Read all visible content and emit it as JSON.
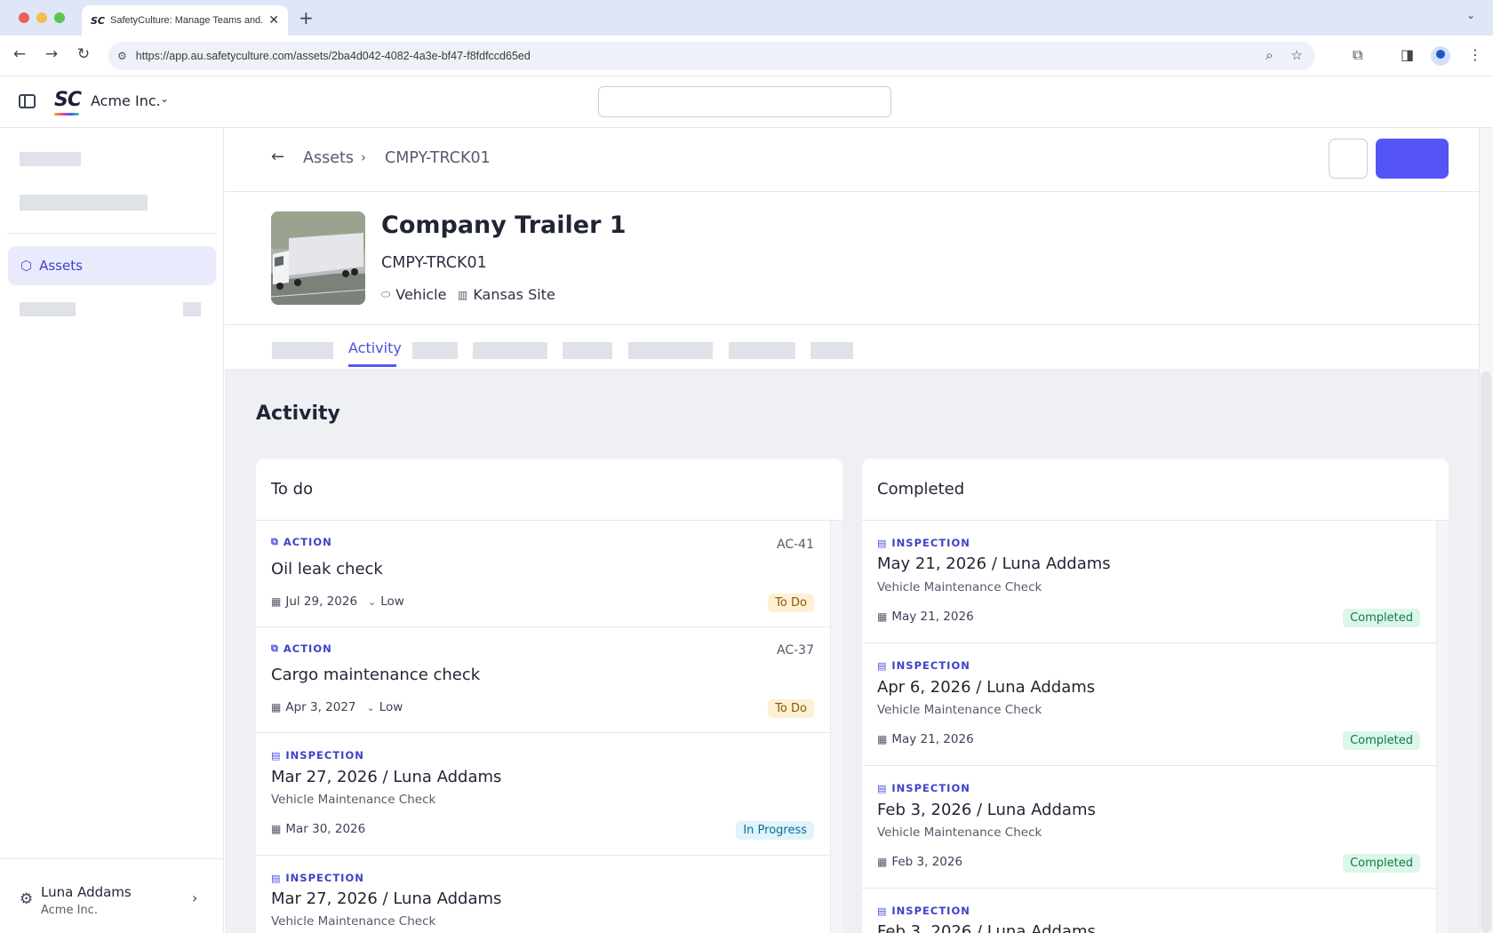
{
  "browser": {
    "tab_title": "SafetyCulture: Manage Teams and...",
    "tab_favicon": "SC",
    "url": "https://app.au.safetyculture.com/assets/2ba4d042-4082-4a3e-bf47-f8fdfccd65ed"
  },
  "header": {
    "logo": "SC",
    "org_name": "Acme Inc."
  },
  "sidebar": {
    "active_item": "Assets",
    "user": {
      "name": "Luna Addams",
      "org": "Acme Inc."
    }
  },
  "breadcrumb": {
    "parent": "Assets",
    "current": "CMPY-TRCK01"
  },
  "asset": {
    "title": "Company Trailer 1",
    "code": "CMPY-TRCK01",
    "type": "Vehicle",
    "site": "Kansas Site"
  },
  "tabs": {
    "active": "Activity"
  },
  "activity": {
    "title": "Activity",
    "todo": {
      "title": "To do",
      "items": [
        {
          "type": "ACTION",
          "id": "AC-41",
          "title": "Oil leak check",
          "date": "Jul 29, 2026",
          "priority": "Low",
          "status": "To Do"
        },
        {
          "type": "ACTION",
          "id": "AC-37",
          "title": "Cargo maintenance check",
          "date": "Apr 3, 2027",
          "priority": "Low",
          "status": "To Do"
        },
        {
          "type": "INSPECTION",
          "title": "Mar 27, 2026 / Luna Addams",
          "subtitle": "Vehicle Maintenance Check",
          "date": "Mar 30, 2026",
          "status": "In Progress"
        },
        {
          "type": "INSPECTION",
          "title": "Mar 27, 2026 / Luna Addams",
          "subtitle": "Vehicle Maintenance Check"
        }
      ]
    },
    "completed": {
      "title": "Completed",
      "items": [
        {
          "type": "INSPECTION",
          "title": "May 21, 2026 / Luna Addams",
          "subtitle": "Vehicle Maintenance Check",
          "date": "May 21, 2026",
          "status": "Completed"
        },
        {
          "type": "INSPECTION",
          "title": "Apr 6, 2026 / Luna Addams",
          "subtitle": "Vehicle Maintenance Check",
          "date": "May 21, 2026",
          "status": "Completed"
        },
        {
          "type": "INSPECTION",
          "title": "Feb 3, 2026 / Luna Addams",
          "subtitle": "Vehicle Maintenance Check",
          "date": "Feb 3, 2026",
          "status": "Completed"
        },
        {
          "type": "INSPECTION",
          "title": "Feb 3, 2026 / Luna Addams"
        }
      ]
    }
  },
  "colors": {
    "accent": "#5555f6",
    "accent_text": "#3d42c7",
    "background": "#eef0f4",
    "todo_badge": "#fdf0d4",
    "progress_badge": "#dff4fb",
    "completed_badge": "#dcf6e9"
  },
  "icons": [
    "sidebar-toggle-icon",
    "chevron-down-icon",
    "cube-icon",
    "gear-icon",
    "chevron-right-icon",
    "back-arrow-icon",
    "tag-icon",
    "building-icon",
    "action-icon",
    "clipboard-icon",
    "calendar-icon",
    "priority-low-icon"
  ]
}
